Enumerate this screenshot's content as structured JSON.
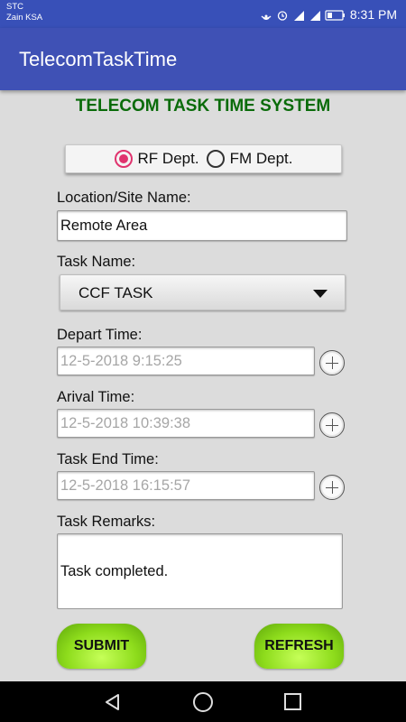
{
  "status_bar": {
    "carrier_1": "STC",
    "carrier_2": "Zain KSA",
    "time": "8:31 PM"
  },
  "app_bar": {
    "title": "TelecomTaskTime"
  },
  "page_title": "TELECOM TASK TIME SYSTEM",
  "department": {
    "options": [
      {
        "label": "RF Dept.",
        "checked": true
      },
      {
        "label": "FM Dept.",
        "checked": false
      }
    ]
  },
  "location": {
    "label": "Location/Site Name:",
    "value": "Remote Area"
  },
  "task_name": {
    "label": "Task Name:",
    "selected": "CCF TASK"
  },
  "depart_time": {
    "label": "Depart Time:",
    "value": "12-5-2018 9:15:25"
  },
  "arrival_time": {
    "label": "Arival Time:",
    "value": "12-5-2018 10:39:38"
  },
  "task_end_time": {
    "label": "Task End Time:",
    "value": "12-5-2018 16:15:57"
  },
  "remarks": {
    "label": "Task Remarks:",
    "value": "Task completed."
  },
  "buttons": {
    "submit": "SUBMIT",
    "refresh": "REFRESH"
  },
  "colors": {
    "app_bar": "#3f51b5",
    "title_green": "#0a6b0a",
    "radio_accent": "#e0336e",
    "button_green": "#8edc1c"
  }
}
